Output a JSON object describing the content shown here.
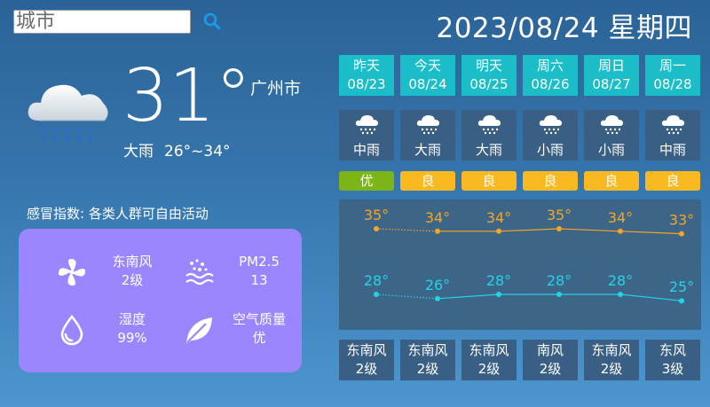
{
  "search": {
    "placeholder": "城市"
  },
  "date_title": "2023/08/24 星期四",
  "current": {
    "temp": "31°",
    "city": "广州市",
    "weather": "大雨",
    "range": "26°~34°",
    "cold_index": "感冒指数: 各类人群可自由活动"
  },
  "info": {
    "wind_label": "东南风",
    "wind_value": "2级",
    "pm_label": "PM2.5",
    "pm_value": "13",
    "humidity_label": "湿度",
    "humidity_value": "99%",
    "aqi_label": "空气质量",
    "aqi_value": "优"
  },
  "days": [
    {
      "name": "昨天",
      "date": "08/23",
      "weather": "中雨",
      "aqi": "优",
      "aqi_color": "#7cb518",
      "high": 35,
      "low": 28,
      "wind": "东南风",
      "wind_level": "2级"
    },
    {
      "name": "今天",
      "date": "08/24",
      "weather": "大雨",
      "aqi": "良",
      "aqi_color": "#fbb921",
      "high": 34,
      "low": 26,
      "wind": "东南风",
      "wind_level": "2级"
    },
    {
      "name": "明天",
      "date": "08/25",
      "weather": "大雨",
      "aqi": "良",
      "aqi_color": "#fbb921",
      "high": 34,
      "low": 28,
      "wind": "东南风",
      "wind_level": "2级"
    },
    {
      "name": "周六",
      "date": "08/26",
      "weather": "小雨",
      "aqi": "良",
      "aqi_color": "#fbb921",
      "high": 35,
      "low": 28,
      "wind": "南风",
      "wind_level": "2级"
    },
    {
      "name": "周日",
      "date": "08/27",
      "weather": "小雨",
      "aqi": "良",
      "aqi_color": "#fbb921",
      "high": 34,
      "low": 28,
      "wind": "东南风",
      "wind_level": "2级"
    },
    {
      "name": "周一",
      "date": "08/28",
      "weather": "中雨",
      "aqi": "良",
      "aqi_color": "#fbb921",
      "high": 33,
      "low": 25,
      "wind": "东风",
      "wind_level": "3级"
    }
  ],
  "colors": {
    "high_line": "#f5a623",
    "low_line": "#23d4e6",
    "header_bg": "#1bbdc9",
    "card_bg": "#9b86ff"
  },
  "icons": [
    "search-icon",
    "heavy-rain-icon",
    "rain-icon",
    "fan-icon",
    "pm-icon",
    "drop-icon",
    "leaf-icon"
  ]
}
